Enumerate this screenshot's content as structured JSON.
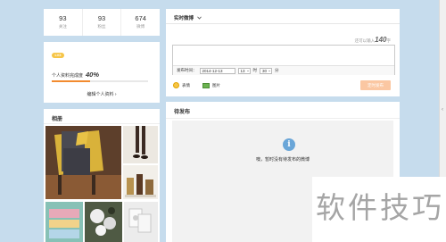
{
  "stats": [
    {
      "num": "93",
      "label": "关注"
    },
    {
      "num": "93",
      "label": "粉丝"
    },
    {
      "num": "674",
      "label": "微博"
    }
  ],
  "profile": {
    "level_badge": "LV3",
    "completeness_label": "个人资料完成度",
    "completeness_value": "40%",
    "completeness_fraction": 0.4,
    "edit_link": "编辑个人资料 ›"
  },
  "album": {
    "title": "相册"
  },
  "composer": {
    "tab_label": "实时微博",
    "hint_prefix": "还可以输入",
    "hint_count": "140",
    "hint_suffix": "字",
    "schedule_label": "发布时间：",
    "schedule_date": "2014-12-13",
    "schedule_hour": "13",
    "hour_unit": "时",
    "schedule_minute": "30",
    "minute_unit": "分",
    "emoji_label": "表情",
    "image_label": "图片",
    "publish_button": "定时发布"
  },
  "pending": {
    "title": "待发布",
    "empty_message": "噢，暂时没有待发布的微博"
  },
  "watermark": {
    "text": "软件技巧"
  },
  "colors": {
    "background": "#c6dced",
    "accent_orange": "#f28b30",
    "publish_disabled": "#fbc7a2",
    "info_blue": "#6aa6d8"
  }
}
